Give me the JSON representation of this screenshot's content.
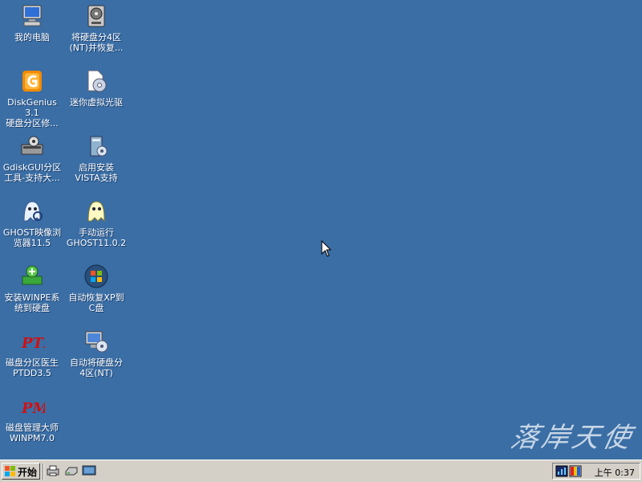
{
  "desktop": {
    "background_color": "#3a6ea5",
    "icons": [
      {
        "label": "我的电脑",
        "icon": "my-computer-icon"
      },
      {
        "label": "将硬盘分4区\n(NT)并恢复...",
        "icon": "disk-partition-restore-icon"
      },
      {
        "label": "DiskGenius 3.1\n硬盘分区修...",
        "icon": "diskgenius-icon"
      },
      {
        "label": "迷你虚拟光驱",
        "icon": "virtual-cd-drive-icon"
      },
      {
        "label": "GdiskGUI分区\n工具-支持大...",
        "icon": "gdiskgui-icon"
      },
      {
        "label": "启用安装\nVISTA支持",
        "icon": "vista-support-icon"
      },
      {
        "label": "GHOST映像浏\n览器11.5",
        "icon": "ghost-explorer-icon"
      },
      {
        "label": "手动运行\nGHOST11.0.2",
        "icon": "ghost-icon"
      },
      {
        "label": "安装WINPE系\n统到硬盘",
        "icon": "install-winpe-icon"
      },
      {
        "label": "自动恢复XP到\nC盘",
        "icon": "windows-xp-restore-icon"
      },
      {
        "label": "磁盘分区医生\nPTDD3.5",
        "icon": "ptdd-icon"
      },
      {
        "label": "自动将硬盘分\n4区(NT)",
        "icon": "auto-partition-icon"
      },
      {
        "label": "磁盘管理大师\nWINPM7.0",
        "icon": "winpm-icon"
      }
    ]
  },
  "watermark": {
    "text": "落岸天使"
  },
  "taskbar": {
    "start_label": "开始",
    "quick_launch": [
      {
        "icon": "printer-icon"
      },
      {
        "icon": "drive-icon"
      },
      {
        "icon": "show-desktop-icon"
      }
    ],
    "tray": {
      "icons": [
        "network-monitor-icon",
        "color-palette-icon"
      ],
      "clock": "上午 0:37"
    }
  }
}
